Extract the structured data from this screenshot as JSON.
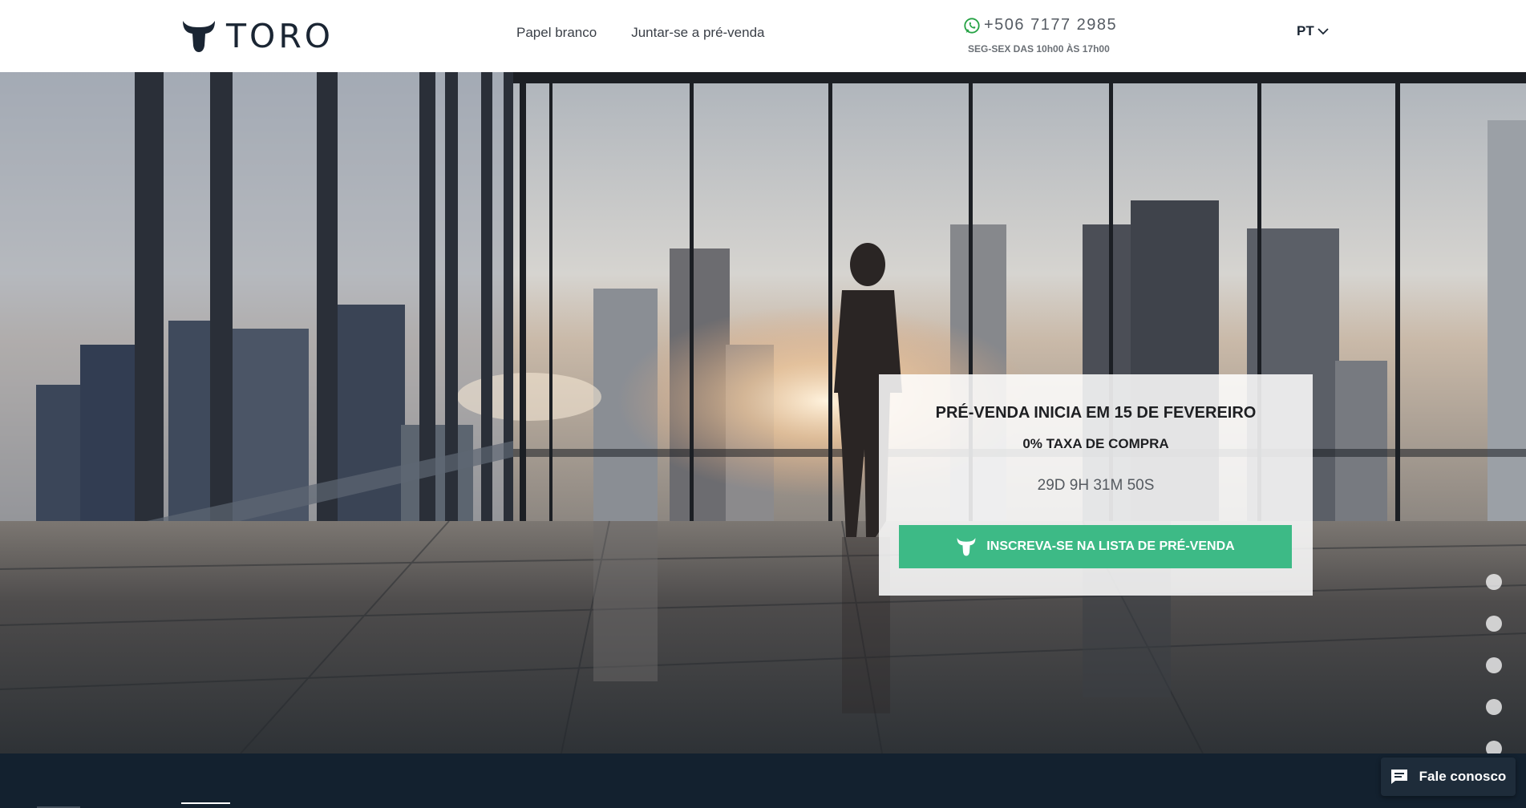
{
  "header": {
    "brand": "TORO",
    "nav": [
      {
        "label": "Papel branco"
      },
      {
        "label": "Juntar-se a pré-venda"
      }
    ],
    "phone": "+506 7177 2985",
    "hours": "SEG-SEX DAS 10h00 ÀS 17h00",
    "language": "PT"
  },
  "presale": {
    "title": "PRÉ-VENDA INICIA EM 15 DE FEVEREIRO",
    "subtitle": "0% TAXA DE COMPRA",
    "countdown": "29D 9H 31M 50S",
    "cta_label": "INSCREVA-SE NA LISTA DE PRÉ-VENDA"
  },
  "slider": {
    "dot_count": 6
  },
  "chat": {
    "label": "Fale conosco"
  },
  "icons": {
    "logo": "bull-head-icon",
    "phone": "whatsapp-icon",
    "language": "chevron-down-icon",
    "cta": "bull-head-icon",
    "chat": "chat-bubble-icon"
  },
  "colors": {
    "accent": "#3dba86",
    "navy": "#13212f",
    "brand_text": "#1a2533",
    "whatsapp": "#25a244"
  }
}
